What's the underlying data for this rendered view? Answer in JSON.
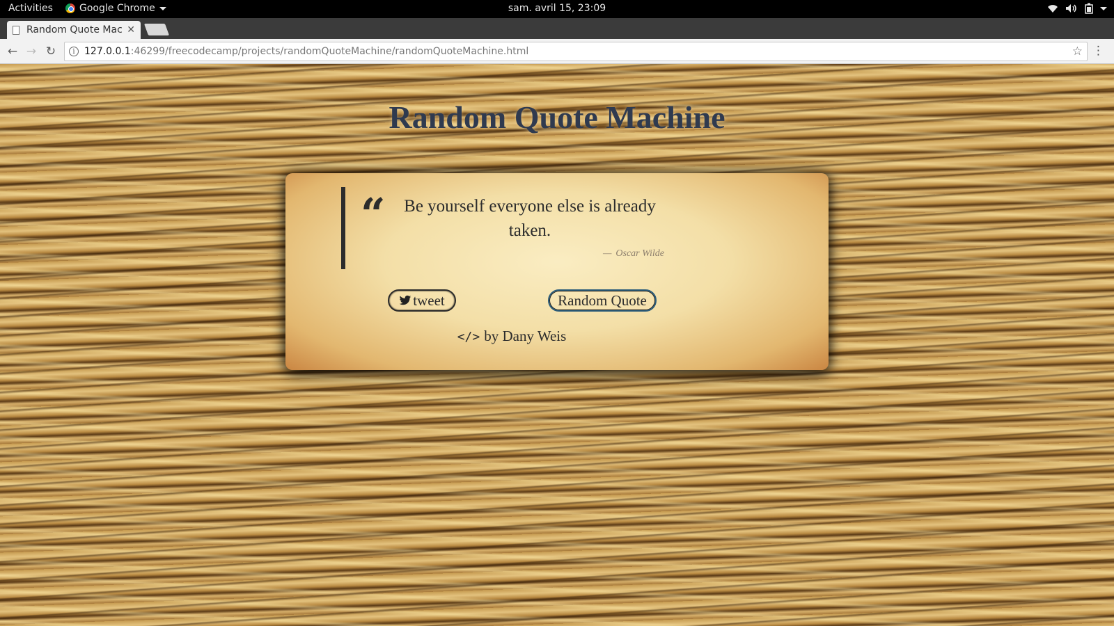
{
  "system": {
    "activities": "Activities",
    "app_name": "Google Chrome",
    "clock": "sam. avril 15, 23:09"
  },
  "browser": {
    "tab_title": "Random Quote Mac",
    "url_host": "127.0.0.1",
    "url_rest": ":46299/freecodecamp/projects/randomQuoteMachine/randomQuoteMachine.html"
  },
  "page": {
    "title": "Random Quote Machine",
    "quote": {
      "text": "Be yourself everyone else is already taken.",
      "dash": "—",
      "author": "Oscar Wilde"
    },
    "buttons": {
      "tweet": "tweet",
      "random": "Random Quote"
    },
    "credit": {
      "code_icon": "</>",
      "text": "by Dany Weis"
    }
  },
  "icons": [
    "chrome-icon",
    "wifi-icon",
    "volume-icon",
    "battery-icon",
    "page-icon",
    "back-icon",
    "forward-icon",
    "reload-icon",
    "info-icon",
    "star-icon",
    "menu-icon",
    "quote-icon",
    "twitter-icon",
    "code-icon"
  ]
}
